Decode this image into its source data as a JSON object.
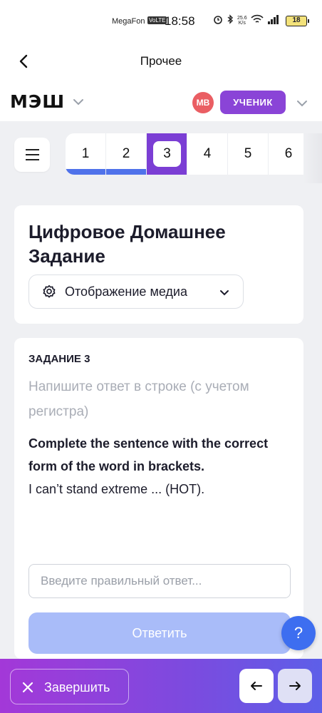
{
  "status_bar": {
    "carrier": "MegaFon",
    "volte": "VoLTE",
    "time": "18:58",
    "speed_value": "25.6",
    "speed_unit": "K/s",
    "battery": "18"
  },
  "header": {
    "title": "Прочее"
  },
  "appbar": {
    "logo": "МЭШ",
    "avatar_initials": "МВ",
    "role": "УЧЕНИК"
  },
  "question_nav": {
    "items": [
      "1",
      "2",
      "3",
      "4",
      "5",
      "6"
    ],
    "current": "3"
  },
  "homework": {
    "title": "Цифровое Домашнее Задание",
    "media_button": "Отображение медиа"
  },
  "task": {
    "number": "ЗАДАНИЕ 3",
    "hint": "Напишите ответ в строке (с учетом регистра)",
    "instruction": "Complete the sentence with the correct form of the word in brackets.",
    "sentence": "I can’t stand extreme ... (HOT).",
    "answer_placeholder": "Введите правильный ответ...",
    "submit_label": "Ответить"
  },
  "help": {
    "label": "?"
  },
  "bottom_bar": {
    "finish_label": "Завершить"
  },
  "colors": {
    "accent": "#7b3ed4",
    "done_bar": "#4f72ea",
    "submit_disabled": "#a9bcf9",
    "help_button": "#3d6ef0"
  }
}
